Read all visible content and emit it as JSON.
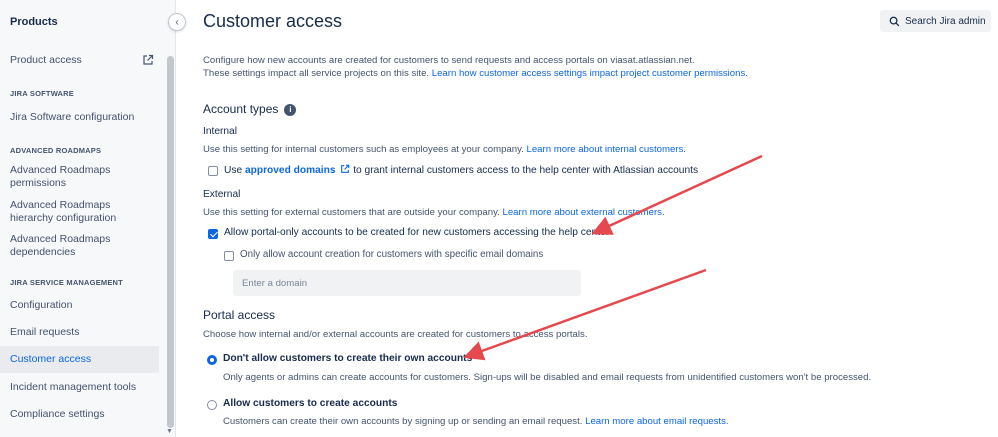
{
  "sidebar": {
    "title": "Products",
    "collapse_glyph": "‹",
    "items": {
      "product_access": "Product access",
      "jira_software_config": "Jira Software configuration",
      "roadmaps_permissions": "Advanced Roadmaps permissions",
      "roadmaps_hierarchy": "Advanced Roadmaps hierarchy configuration",
      "roadmaps_dependencies": "Advanced Roadmaps dependencies",
      "configuration": "Configuration",
      "email_requests": "Email requests",
      "customer_access": "Customer access",
      "incident_tools": "Incident management tools",
      "compliance": "Compliance settings"
    },
    "headings": {
      "jira_software": "JIRA SOFTWARE",
      "advanced_roadmaps": "ADVANCED ROADMAPS",
      "jsm": "JIRA SERVICE MANAGEMENT"
    }
  },
  "header": {
    "title": "Customer access",
    "search_label": "Search Jira admin"
  },
  "intro": {
    "line1": "Configure how new accounts are created for customers to send requests and access portals on viasat.atlassian.net.",
    "line2_text": "These settings impact all service projects on this site. ",
    "line2_link": "Learn how customer access settings impact project customer permissions."
  },
  "account_types": {
    "title": "Account types",
    "info_glyph": "i",
    "internal": {
      "title": "Internal",
      "desc_text": "Use this setting for internal customers such as employees at your company. ",
      "desc_link": "Learn more about internal customers.",
      "checkbox_pre": "Use ",
      "checkbox_link": "approved domains",
      "checkbox_post": " to grant internal customers access to the help center with Atlassian accounts"
    },
    "external": {
      "title": "External",
      "desc_text": "Use this setting for external customers that are outside your company. ",
      "desc_link": "Learn more about external customers.",
      "allow_portal_label": "Allow portal-only accounts to be created for new customers accessing the help center",
      "restrict_label": "Only allow account creation for customers with specific email domains",
      "domain_placeholder": "Enter a domain"
    }
  },
  "portal_access": {
    "title": "Portal access",
    "desc": "Choose how internal and/or external accounts are created for customers to access portals.",
    "options": [
      {
        "label": "Don't allow customers to create their own accounts",
        "desc": "Only agents or admins can create accounts for customers. Sign-ups will be disabled and email requests from unidentified customers won't be processed.",
        "selected": true
      },
      {
        "label": "Allow customers to create accounts",
        "desc_text": "Customers can create their own accounts by signing up or sending an email request. ",
        "desc_link": "Learn more about email requests.",
        "selected": false
      }
    ]
  },
  "colors": {
    "accent": "#0c66e4",
    "annotation_arrow": "#e5484d"
  }
}
